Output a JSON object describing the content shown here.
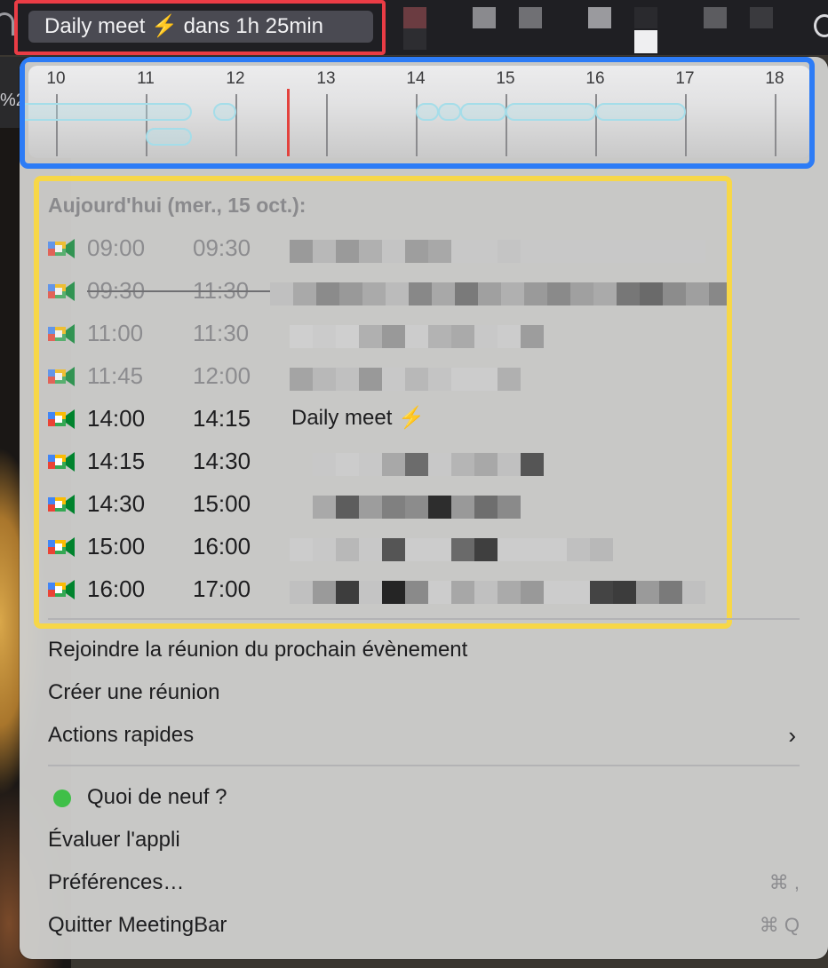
{
  "statusbar": {
    "label": "Daily meet ⚡️ dans 1h 25min"
  },
  "background": {
    "left_text": "%2"
  },
  "timeline": {
    "hours": [
      "10",
      "11",
      "12",
      "13",
      "14",
      "15",
      "16",
      "17",
      "18"
    ],
    "now_marker_color": "#e3423d"
  },
  "events": {
    "section_title": "Aujourd'hui (mer., 15 oct.):",
    "rows": [
      {
        "start": "09:00",
        "end": "09:30",
        "title": "",
        "state": "past",
        "strikethrough": false
      },
      {
        "start": "09:30",
        "end": "11:30",
        "title": "",
        "state": "past",
        "strikethrough": true
      },
      {
        "start": "11:00",
        "end": "11:30",
        "title": "",
        "state": "past",
        "strikethrough": false
      },
      {
        "start": "11:45",
        "end": "12:00",
        "title": "",
        "state": "past",
        "strikethrough": false
      },
      {
        "start": "14:00",
        "end": "14:15",
        "title": "Daily meet ⚡️",
        "state": "future",
        "strikethrough": false
      },
      {
        "start": "14:15",
        "end": "14:30",
        "title": "",
        "state": "future",
        "strikethrough": false
      },
      {
        "start": "14:30",
        "end": "15:00",
        "title": "",
        "state": "future",
        "strikethrough": false
      },
      {
        "start": "15:00",
        "end": "16:00",
        "title": "",
        "state": "future",
        "strikethrough": false
      },
      {
        "start": "16:00",
        "end": "17:00",
        "title": "",
        "state": "future",
        "strikethrough": false
      }
    ],
    "icon": "google-meet-icon"
  },
  "actions": {
    "join_next": "Rejoindre la réunion du prochain évènement",
    "create_meeting": "Créer une réunion",
    "quick_actions": "Actions rapides",
    "quick_actions_chevron": "›"
  },
  "app": {
    "whats_new": "Quoi de neuf ?",
    "whats_new_dot_color": "#3fbf48",
    "rate_app": "Évaluer l'appli",
    "preferences": "Préférences…",
    "preferences_shortcut": "⌘ ,",
    "quit": "Quitter MeetingBar",
    "quit_shortcut": "⌘ Q"
  },
  "highlights": {
    "red": "#ea3c45",
    "blue": "#2d7cf6",
    "yellow": "#f7d748"
  }
}
